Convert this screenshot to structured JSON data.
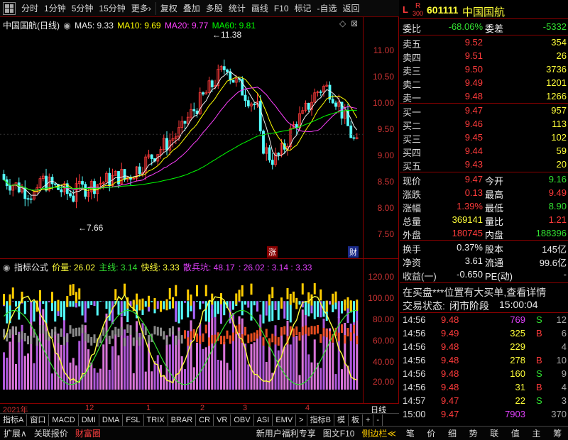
{
  "toolbar": {
    "items": [
      "分时",
      "1分钟",
      "5分钟",
      "15分钟",
      "更多",
      "复权",
      "叠加",
      "多股",
      "统计",
      "画线",
      "F10",
      "标记",
      "-自选",
      "返回"
    ],
    "more_arrow": "›"
  },
  "kline": {
    "title": "中国国航(日线)",
    "ma5": "MA5: 9.33",
    "ma10": "MA10: 9.69",
    "ma20": "MA20: 9.77",
    "ma60": "MA60: 9.81",
    "high_mark": "11.38",
    "low_mark": "7.66",
    "zhang": "涨",
    "cai": "财",
    "yticks": [
      "11.00",
      "10.50",
      "10.00",
      "9.50",
      "9.00",
      "8.50",
      "8.00",
      "7.50"
    ],
    "colors": {
      "ma5": "#eeeeee",
      "ma10": "#ffff00",
      "ma20": "#ff40ff",
      "ma60": "#00ff00",
      "up": "#ff3b3b",
      "down": "#54ffff"
    }
  },
  "indicator": {
    "title": "指标公式",
    "jl": "价量: 26.02",
    "zx": "主线: 3.14",
    "kx": "快线: 3.33",
    "sbk": "散兵坑: 48.17",
    "tail": ": 26.02 : 3.14 : 3.33",
    "yticks": [
      "120.00",
      "100.00",
      "80.00",
      "60.00",
      "40.00",
      "20.00"
    ]
  },
  "timeaxis": {
    "labels": [
      "2021年",
      "12",
      "1",
      "2",
      "3",
      "4"
    ],
    "period": "日线"
  },
  "tabs1": [
    "指标A",
    "窗口",
    "MACD",
    "DMI",
    "DMA",
    "FSL",
    "TRIX",
    "BRAR",
    "CR",
    "VR",
    "OBV",
    "ASI",
    "EMV",
    ">",
    "指标B",
    "模",
    "板",
    "+",
    "-"
  ],
  "tabs2": {
    "left": [
      "扩展∧",
      "关联报价",
      "财富圈"
    ],
    "mid": [
      "新用户福利专享",
      "图文F10",
      "侧边栏≪"
    ],
    "right": [
      "笔",
      "价",
      "细",
      "势",
      "联",
      "值",
      "主",
      "筹"
    ]
  },
  "quote": {
    "market_l": "L",
    "market_r": "R",
    "index": "300",
    "code": "601111",
    "name": "中国国航",
    "weibi_label": "委比",
    "weibi": "-68.06%",
    "weicha_label": "委差",
    "weicha": "-5332",
    "sells": [
      {
        "label": "卖五",
        "price": "9.52",
        "vol": "354"
      },
      {
        "label": "卖四",
        "price": "9.51",
        "vol": "26"
      },
      {
        "label": "卖三",
        "price": "9.50",
        "vol": "3736"
      },
      {
        "label": "卖二",
        "price": "9.49",
        "vol": "1201"
      },
      {
        "label": "卖一",
        "price": "9.48",
        "vol": "1266"
      }
    ],
    "buys": [
      {
        "label": "买一",
        "price": "9.47",
        "vol": "957"
      },
      {
        "label": "买二",
        "price": "9.46",
        "vol": "113"
      },
      {
        "label": "买三",
        "price": "9.45",
        "vol": "102"
      },
      {
        "label": "买四",
        "price": "9.44",
        "vol": "59"
      },
      {
        "label": "买五",
        "price": "9.43",
        "vol": "20"
      }
    ],
    "stats": [
      {
        "l1": "现价",
        "v1": "9.47",
        "c1": "red",
        "l2": "今开",
        "v2": "9.16",
        "c2": "green"
      },
      {
        "l1": "涨跌",
        "v1": "0.13",
        "c1": "red",
        "l2": "最高",
        "v2": "9.49",
        "c2": "red"
      },
      {
        "l1": "涨幅",
        "v1": "1.39%",
        "c1": "red",
        "l2": "最低",
        "v2": "8.90",
        "c2": "green"
      },
      {
        "l1": "总量",
        "v1": "369141",
        "c1": "yellow",
        "l2": "量比",
        "v2": "1.21",
        "c2": "red"
      },
      {
        "l1": "外盘",
        "v1": "180745",
        "c1": "red",
        "l2": "内盘",
        "v2": "188396",
        "c2": "green"
      }
    ],
    "stats2": [
      {
        "l1": "换手",
        "v1": "0.37%",
        "c1": "white",
        "l2": "股本",
        "v2": "145亿",
        "c2": "white"
      },
      {
        "l1": "净资",
        "v1": "3.61",
        "c1": "white",
        "l2": "流通",
        "v2": "99.6亿",
        "c2": "white"
      },
      {
        "l1": "收益(一)",
        "v1": "-0.650",
        "c1": "white",
        "l2": "PE(动)",
        "v2": "-",
        "c2": "white"
      }
    ],
    "notice": "在买盘***位置有大买单,查看详情",
    "status_label": "交易状态:",
    "status": "闭市阶段",
    "status_time": "15:00:04",
    "ticks": [
      {
        "t": "14:56",
        "p": "9.48",
        "v": "769",
        "vc": "magenta",
        "bs": "S",
        "bc": "green",
        "n": "12"
      },
      {
        "t": "14:56",
        "p": "9.49",
        "v": "325",
        "vc": "yellow",
        "bs": "B",
        "bc": "red",
        "n": "6"
      },
      {
        "t": "14:56",
        "p": "9.48",
        "v": "229",
        "vc": "yellow",
        "bs": "",
        "bc": "green",
        "n": "4"
      },
      {
        "t": "14:56",
        "p": "9.48",
        "v": "278",
        "vc": "yellow",
        "bs": "B",
        "bc": "red",
        "n": "10"
      },
      {
        "t": "14:56",
        "p": "9.48",
        "v": "160",
        "vc": "yellow",
        "bs": "S",
        "bc": "green",
        "n": "9"
      },
      {
        "t": "14:56",
        "p": "9.48",
        "v": "31",
        "vc": "yellow",
        "bs": "B",
        "bc": "red",
        "n": "4"
      },
      {
        "t": "14:57",
        "p": "9.47",
        "v": "22",
        "vc": "yellow",
        "bs": "S",
        "bc": "green",
        "n": "3"
      },
      {
        "t": "15:00",
        "p": "9.47",
        "v": "7903",
        "vc": "magenta",
        "bs": "",
        "bc": "green",
        "n": "370"
      }
    ]
  }
}
